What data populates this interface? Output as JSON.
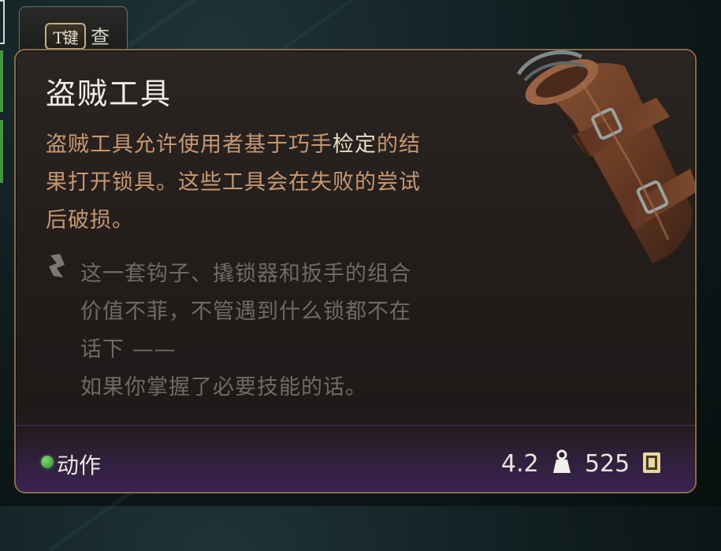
{
  "key_hint": {
    "key": "T键",
    "label": "查看"
  },
  "item": {
    "name": "盗贼工具",
    "description_lines": [
      "盗贼工具允许使用者基于巧手",
      "检定",
      "的结",
      "果打开锁具。这些工具会在失败的尝试",
      "后破损。"
    ],
    "quote_lines": [
      "这一套钩子、撬锁器和扳手的组合",
      "价值不菲，不管遇到什么锁都不在",
      "话下 ——",
      "如果你掌握了必要技能的话。"
    ]
  },
  "footer": {
    "action_label": "动作",
    "weight": "4.2",
    "price": "525",
    "icons": {
      "weight": "weight-icon",
      "gold": "gold-coin-icon",
      "action": "action-dot-icon"
    }
  },
  "colors": {
    "panel_border": "#8a6b4a",
    "description": "#c79870",
    "quote": "#6f6a66",
    "title": "#f0ece4",
    "action_green": "#3f9a3a"
  }
}
